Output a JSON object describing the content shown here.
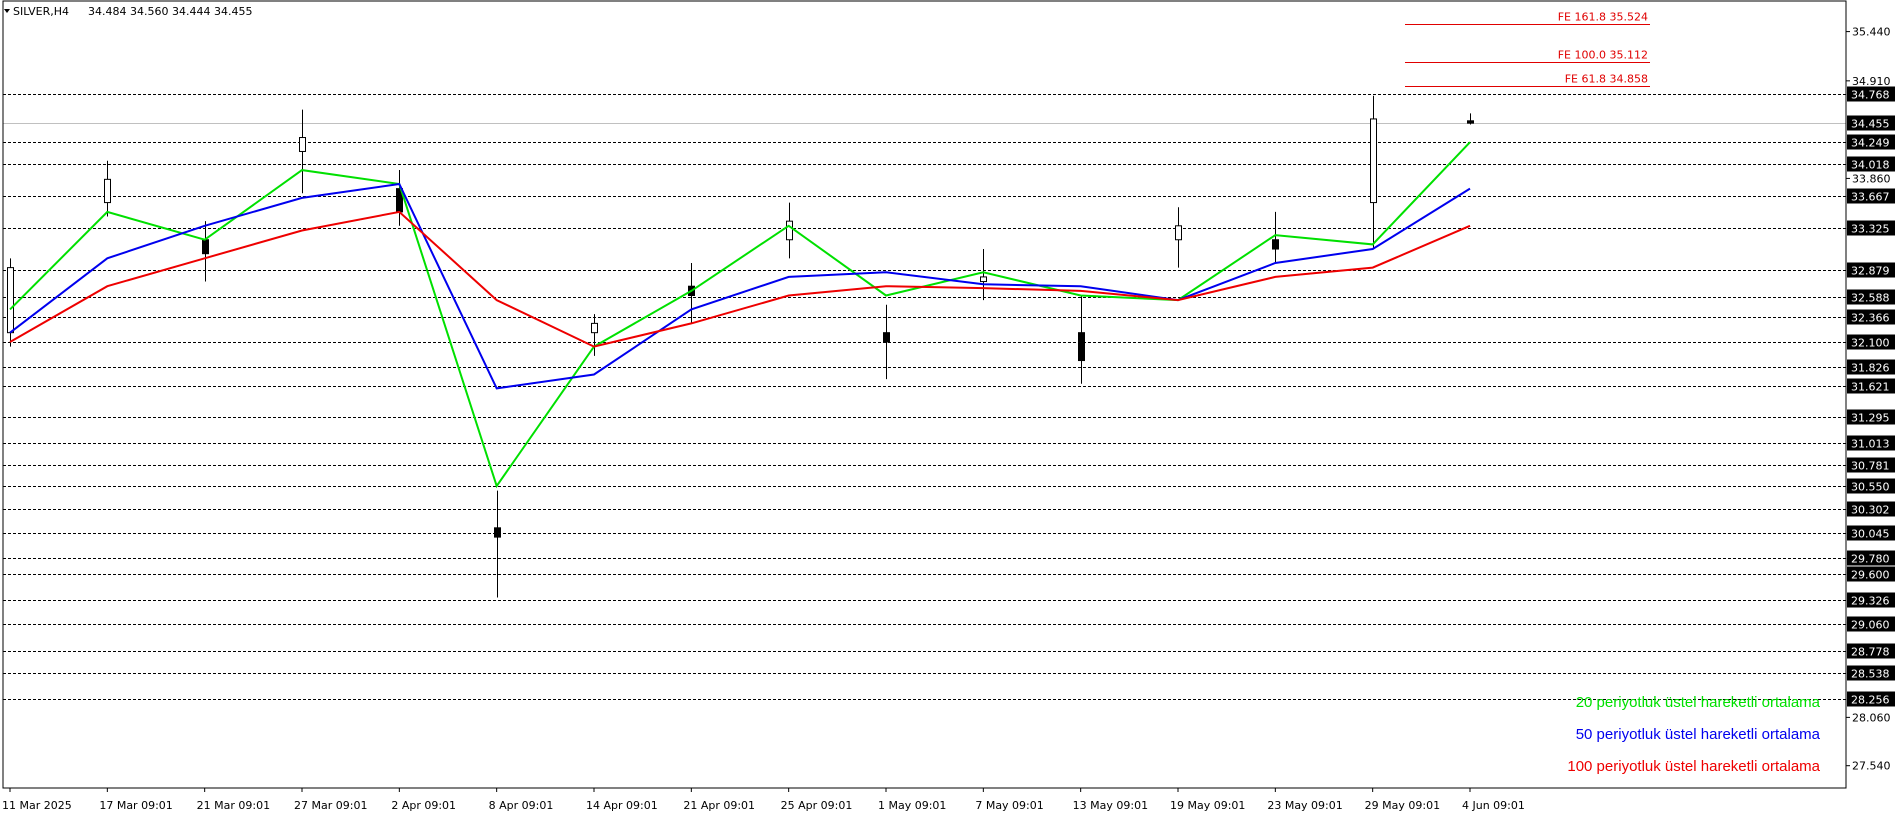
{
  "header": {
    "symbol": "SILVER,H4",
    "ohlc": "34.484 34.560 34.444 34.455"
  },
  "colors": {
    "ema20": "#00e000",
    "ema50": "#0000ee",
    "ema100": "#ee0000",
    "fib": "#e00000",
    "candle": "#000000",
    "grid": "#000000"
  },
  "chart_data": {
    "type": "candlestick",
    "symbol": "SILVER",
    "timeframe": "H4",
    "ylim": [
      27.3,
      35.78
    ],
    "x_ticks": [
      "11 Mar 2025",
      "17 Mar 09:01",
      "21 Mar 09:01",
      "27 Mar 09:01",
      "2 Apr 09:01",
      "8 Apr 09:01",
      "14 Apr 09:01",
      "21 Apr 09:01",
      "25 Apr 09:01",
      "1 May 09:01",
      "7 May 09:01",
      "13 May 09:01",
      "19 May 09:01",
      "23 May 09:01",
      "29 May 09:01",
      "4 Jun 09:01"
    ],
    "y_ticks": [
      "35.440",
      "34.910",
      "33.860",
      "28.060",
      "27.540"
    ],
    "price_levels": [
      "34.768",
      "34.249",
      "34.018",
      "33.667",
      "33.325",
      "32.879",
      "32.588",
      "32.366",
      "32.100",
      "31.826",
      "31.621",
      "31.295",
      "31.013",
      "30.781",
      "30.550",
      "30.302",
      "30.045",
      "29.780",
      "29.600",
      "29.326",
      "29.060",
      "28.778",
      "28.538",
      "28.256"
    ],
    "current_price": "34.455",
    "fib_levels": [
      {
        "label": "FE 161.8 35.524",
        "value": 35.524
      },
      {
        "label": "FE 100.0 35.112",
        "value": 35.112
      },
      {
        "label": "FE 61.8 34.858",
        "value": 34.858
      }
    ],
    "series": [
      {
        "name": "20 periyotluk üstel hareketli ortalama",
        "key": "ema20",
        "x": [
          "11 Mar 2025",
          "17 Mar 09:01",
          "21 Mar 09:01",
          "27 Mar 09:01",
          "2 Apr 09:01",
          "8 Apr 09:01",
          "14 Apr 09:01",
          "21 Apr 09:01",
          "25 Apr 09:01",
          "1 May 09:01",
          "7 May 09:01",
          "13 May 09:01",
          "19 May 09:01",
          "23 May 09:01",
          "29 May 09:01",
          "4 Jun 09:01"
        ],
        "values": [
          32.45,
          33.5,
          33.2,
          33.95,
          33.8,
          30.55,
          32.05,
          32.65,
          33.35,
          32.6,
          32.85,
          32.6,
          32.55,
          33.25,
          33.15,
          34.25
        ]
      },
      {
        "name": "50 periyotluk üstel hareketli ortalama",
        "key": "ema50",
        "x": [
          "11 Mar 2025",
          "17 Mar 09:01",
          "21 Mar 09:01",
          "27 Mar 09:01",
          "2 Apr 09:01",
          "8 Apr 09:01",
          "14 Apr 09:01",
          "21 Apr 09:01",
          "25 Apr 09:01",
          "1 May 09:01",
          "7 May 09:01",
          "13 May 09:01",
          "19 May 09:01",
          "23 May 09:01",
          "29 May 09:01",
          "4 Jun 09:01"
        ],
        "values": [
          32.2,
          33.0,
          33.35,
          33.65,
          33.8,
          31.6,
          31.75,
          32.45,
          32.8,
          32.85,
          32.72,
          32.7,
          32.55,
          32.95,
          33.1,
          33.75
        ]
      },
      {
        "name": "100 periyotluk üstel hareketli ortalama",
        "key": "ema100",
        "x": [
          "11 Mar 2025",
          "17 Mar 09:01",
          "21 Mar 09:01",
          "27 Mar 09:01",
          "2 Apr 09:01",
          "8 Apr 09:01",
          "14 Apr 09:01",
          "21 Apr 09:01",
          "25 Apr 09:01",
          "1 May 09:01",
          "7 May 09:01",
          "13 May 09:01",
          "19 May 09:01",
          "23 May 09:01",
          "29 May 09:01",
          "4 Jun 09:01"
        ],
        "values": [
          32.1,
          32.7,
          33.0,
          33.3,
          33.5,
          32.55,
          32.05,
          32.3,
          32.6,
          32.7,
          32.68,
          32.65,
          32.55,
          32.8,
          32.9,
          33.35
        ]
      }
    ],
    "candles": [
      {
        "x": "11 Mar 2025",
        "o": 32.2,
        "h": 33.0,
        "l": 32.05,
        "c": 32.9
      },
      {
        "x": "17 Mar 09:01",
        "o": 33.6,
        "h": 34.05,
        "l": 33.45,
        "c": 33.85
      },
      {
        "x": "21 Mar 09:01",
        "o": 33.2,
        "h": 33.4,
        "l": 32.75,
        "c": 33.05
      },
      {
        "x": "27 Mar 09:01",
        "o": 34.15,
        "h": 34.6,
        "l": 33.7,
        "c": 34.3
      },
      {
        "x": "2 Apr 09:01",
        "o": 33.75,
        "h": 33.95,
        "l": 33.35,
        "c": 33.5
      },
      {
        "x": "8 Apr 09:01",
        "o": 30.1,
        "h": 30.5,
        "l": 29.35,
        "c": 30.0
      },
      {
        "x": "14 Apr 09:01",
        "o": 32.2,
        "h": 32.4,
        "l": 31.95,
        "c": 32.3
      },
      {
        "x": "21 Apr 09:01",
        "o": 32.7,
        "h": 32.95,
        "l": 32.3,
        "c": 32.6
      },
      {
        "x": "25 Apr 09:01",
        "o": 33.2,
        "h": 33.6,
        "l": 33.0,
        "c": 33.4
      },
      {
        "x": "1 May 09:01",
        "o": 32.2,
        "h": 32.5,
        "l": 31.7,
        "c": 32.1
      },
      {
        "x": "7 May 09:01",
        "o": 32.75,
        "h": 33.1,
        "l": 32.55,
        "c": 32.8
      },
      {
        "x": "13 May 09:01",
        "o": 32.2,
        "h": 32.6,
        "l": 31.65,
        "c": 31.9
      },
      {
        "x": "19 May 09:01",
        "o": 33.2,
        "h": 33.55,
        "l": 32.9,
        "c": 33.35
      },
      {
        "x": "23 May 09:01",
        "o": 33.2,
        "h": 33.5,
        "l": 32.95,
        "c": 33.1
      },
      {
        "x": "29 May 09:01",
        "o": 33.6,
        "h": 34.75,
        "l": 33.1,
        "c": 34.5
      },
      {
        "x": "4 Jun 09:01",
        "o": 34.48,
        "h": 34.56,
        "l": 34.44,
        "c": 34.455
      }
    ]
  }
}
